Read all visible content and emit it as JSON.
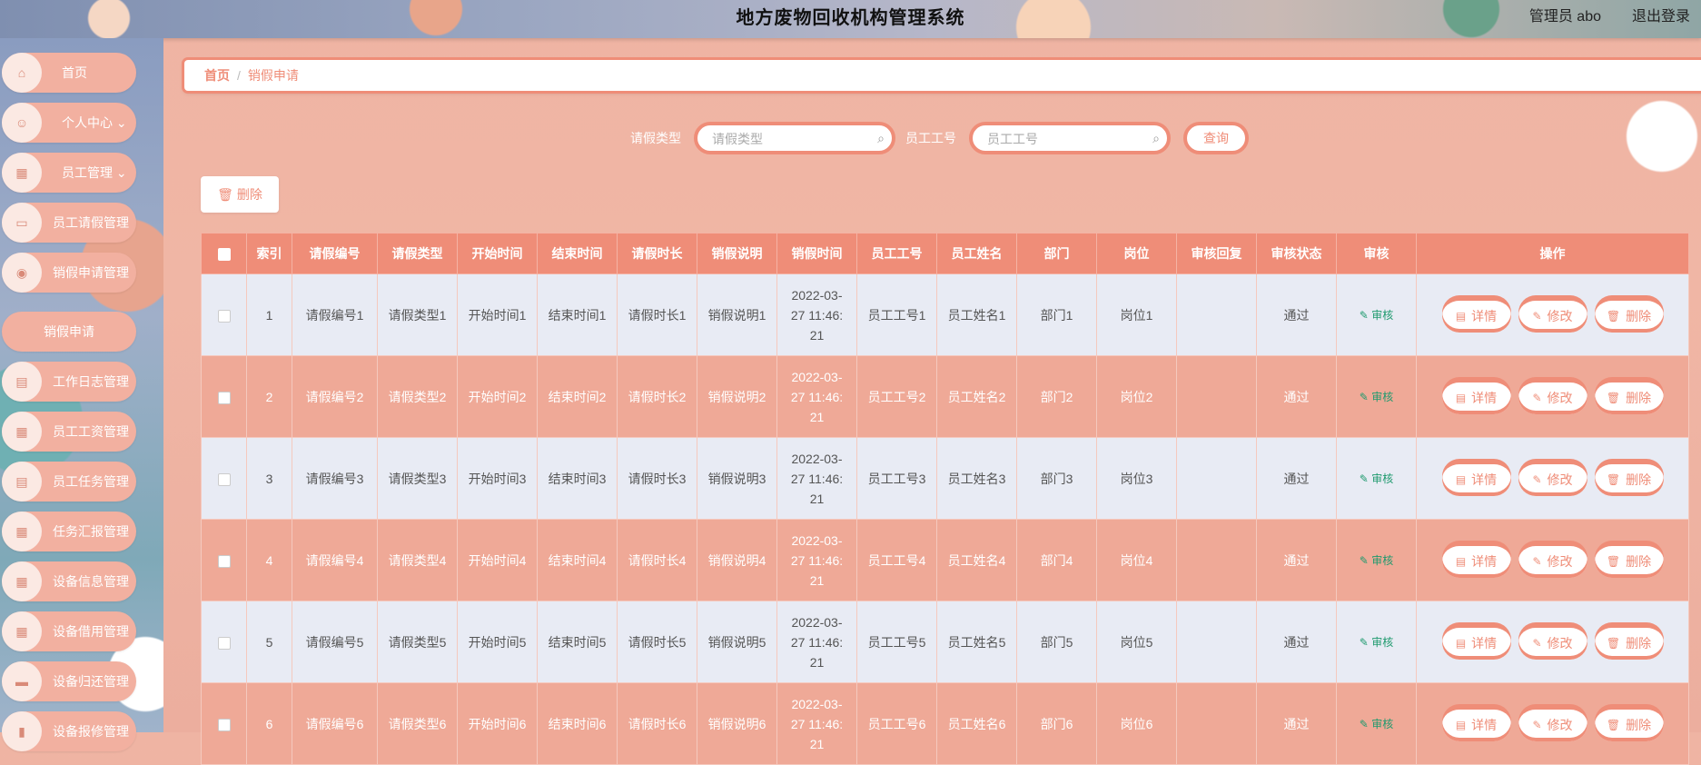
{
  "header": {
    "title": "地方废物回收机构管理系统",
    "admin": "管理员 abo",
    "logout": "退出登录"
  },
  "sidebar": {
    "items": [
      {
        "label": "首页",
        "icon": "home-icon"
      },
      {
        "label": "个人中心",
        "icon": "user-icon",
        "arrow": true
      },
      {
        "label": "员工管理",
        "icon": "chart-icon",
        "arrow": true
      },
      {
        "label": "员工请假管理",
        "icon": "briefcase-icon"
      },
      {
        "label": "销假申请管理",
        "icon": "location-icon"
      },
      {
        "label": "销假申请",
        "sub": true
      },
      {
        "label": "工作日志管理",
        "icon": "clipboard-icon"
      },
      {
        "label": "员工工资管理",
        "icon": "grid-icon"
      },
      {
        "label": "员工任务管理",
        "icon": "clipboard-icon"
      },
      {
        "label": "任务汇报管理",
        "icon": "grid-icon"
      },
      {
        "label": "设备信息管理",
        "icon": "grid-icon"
      },
      {
        "label": "设备借用管理",
        "icon": "grid-icon"
      },
      {
        "label": "设备归还管理",
        "icon": "chat-icon"
      },
      {
        "label": "设备报修管理",
        "icon": "book-icon"
      }
    ]
  },
  "breadcrumb": {
    "home": "首页",
    "sep": "/",
    "current": "销假申请"
  },
  "search": {
    "leave_type_label": "请假类型",
    "leave_type_placeholder": "请假类型",
    "emp_no_label": "员工工号",
    "emp_no_placeholder": "员工工号",
    "query_label": "查询"
  },
  "toolbar": {
    "delete_label": "删除"
  },
  "table": {
    "headers": [
      "索引",
      "请假编号",
      "请假类型",
      "开始时间",
      "结束时间",
      "请假时长",
      "销假说明",
      "销假时间",
      "员工工号",
      "员工姓名",
      "部门",
      "岗位",
      "审核回复",
      "审核状态",
      "审核",
      "操作"
    ],
    "audit_label": "审核",
    "ops": {
      "detail": "详情",
      "edit": "修改",
      "delete": "删除"
    },
    "rows": [
      {
        "idx": "1",
        "no": "请假编号1",
        "type": "请假类型1",
        "start": "开始时间1",
        "end": "结束时间1",
        "dur": "请假时长1",
        "desc": "销假说明1",
        "time_a": "2022-03-",
        "time_b": "27 11:46:",
        "time_c": "21",
        "emp_no": "员工工号1",
        "emp_name": "员工姓名1",
        "dept": "部门1",
        "post": "岗位1",
        "reply": "",
        "status": "通过"
      },
      {
        "idx": "2",
        "no": "请假编号2",
        "type": "请假类型2",
        "start": "开始时间2",
        "end": "结束时间2",
        "dur": "请假时长2",
        "desc": "销假说明2",
        "time_a": "2022-03-",
        "time_b": "27 11:46:",
        "time_c": "21",
        "emp_no": "员工工号2",
        "emp_name": "员工姓名2",
        "dept": "部门2",
        "post": "岗位2",
        "reply": "",
        "status": "通过"
      },
      {
        "idx": "3",
        "no": "请假编号3",
        "type": "请假类型3",
        "start": "开始时间3",
        "end": "结束时间3",
        "dur": "请假时长3",
        "desc": "销假说明3",
        "time_a": "2022-03-",
        "time_b": "27 11:46:",
        "time_c": "21",
        "emp_no": "员工工号3",
        "emp_name": "员工姓名3",
        "dept": "部门3",
        "post": "岗位3",
        "reply": "",
        "status": "通过"
      },
      {
        "idx": "4",
        "no": "请假编号4",
        "type": "请假类型4",
        "start": "开始时间4",
        "end": "结束时间4",
        "dur": "请假时长4",
        "desc": "销假说明4",
        "time_a": "2022-03-",
        "time_b": "27 11:46:",
        "time_c": "21",
        "emp_no": "员工工号4",
        "emp_name": "员工姓名4",
        "dept": "部门4",
        "post": "岗位4",
        "reply": "",
        "status": "通过"
      },
      {
        "idx": "5",
        "no": "请假编号5",
        "type": "请假类型5",
        "start": "开始时间5",
        "end": "结束时间5",
        "dur": "请假时长5",
        "desc": "销假说明5",
        "time_a": "2022-03-",
        "time_b": "27 11:46:",
        "time_c": "21",
        "emp_no": "员工工号5",
        "emp_name": "员工姓名5",
        "dept": "部门5",
        "post": "岗位5",
        "reply": "",
        "status": "通过"
      },
      {
        "idx": "6",
        "no": "请假编号6",
        "type": "请假类型6",
        "start": "开始时间6",
        "end": "结束时间6",
        "dur": "请假时长6",
        "desc": "销假说明6",
        "time_a": "2022-03-",
        "time_b": "27 11:46:",
        "time_c": "21",
        "emp_no": "员工工号6",
        "emp_name": "员工姓名6",
        "dept": "部门6",
        "post": "岗位6",
        "reply": "",
        "status": "通过"
      }
    ]
  },
  "colors": {
    "accent": "#ef8d78",
    "row_alt": "#efa997",
    "row_light": "#e8ebf4",
    "audit_green": "#1f9a6e"
  }
}
